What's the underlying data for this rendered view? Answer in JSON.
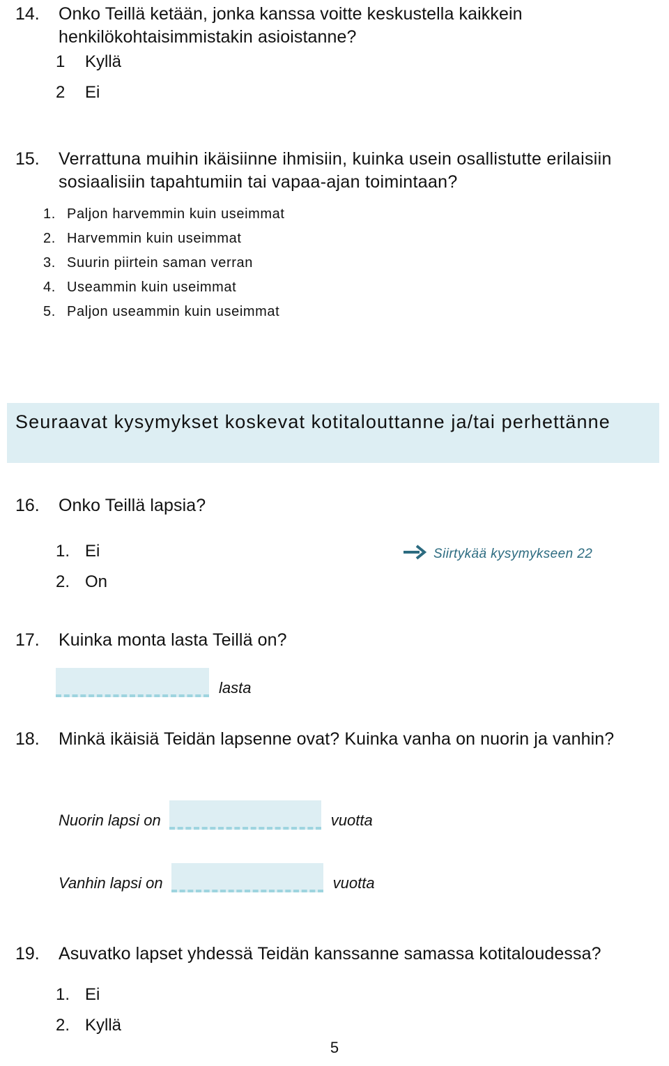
{
  "document": {
    "language": "fi",
    "page_number": "5"
  },
  "questions": [
    {
      "number": "14.",
      "text": "Onko Teillä ketään, jonka kanssa voitte keskustella kaikkein henkilökohtaisimmistakin asioistanne?",
      "options": [
        {
          "num": "1",
          "label": "Kyllä"
        },
        {
          "num": "2",
          "label": "Ei"
        }
      ]
    },
    {
      "number": "15.",
      "text": "Verrattuna muihin ikäisiinne ihmisiin, kuinka usein osallistutte erilaisiin sosiaalisiin tapahtumiin tai vapaa-ajan toimintaan?",
      "options": [
        {
          "num": "1.",
          "label": "Paljon harvemmin kuin useimmat"
        },
        {
          "num": "2.",
          "label": "Harvemmin kuin useimmat"
        },
        {
          "num": "3.",
          "label": "Suurin piirtein saman verran"
        },
        {
          "num": "4.",
          "label": "Useammin kuin useimmat"
        },
        {
          "num": "5.",
          "label": "Paljon useammin kuin useimmat"
        }
      ]
    },
    {
      "number": "16.",
      "text": "Onko Teillä lapsia?",
      "options": [
        {
          "num": "1.",
          "label": "Ei"
        },
        {
          "num": "2.",
          "label": "On"
        }
      ],
      "skip_note": {
        "icon": "arrow-right-icon",
        "text": "Siirtykää kysymykseen 22"
      }
    },
    {
      "number": "17.",
      "text": "Kuinka monta lasta Teillä on?",
      "blanks": [
        {
          "lead": "",
          "value": "",
          "unit": "lasta"
        }
      ]
    },
    {
      "number": "18.",
      "text": "Minkä ikäisiä Teidän lapsenne ovat? Kuinka vanha on nuorin ja vanhin?",
      "blanks": [
        {
          "lead": "Nuorin lapsi on",
          "value": "",
          "unit": "vuotta"
        },
        {
          "lead": "Vanhin lapsi on",
          "value": "",
          "unit": "vuotta"
        }
      ]
    },
    {
      "number": "19.",
      "text": "Asuvatko lapset yhdessä Teidän kanssanne samassa kotitaloudessa?",
      "options": [
        {
          "num": "1.",
          "label": "Ei"
        },
        {
          "num": "2.",
          "label": "Kyllä"
        }
      ]
    }
  ],
  "section_banner": {
    "text": "Seuraavat kysymykset koskevat kotitalouttanne ja/tai perhettänne"
  },
  "colors": {
    "banner_background": "#ddeef3",
    "blank_fill": "#ddeef3",
    "blank_underline": "#9ed4df",
    "skip_accent": "#2c6b80",
    "text": "#111111"
  }
}
